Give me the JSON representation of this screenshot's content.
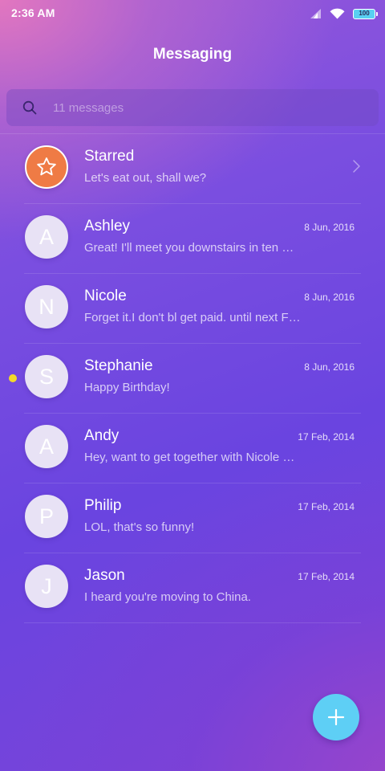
{
  "status_bar": {
    "time": "2:36 AM",
    "battery": "100",
    "icons": [
      "signal-icon",
      "wifi-icon",
      "battery-icon"
    ]
  },
  "header": {
    "title": "Messaging"
  },
  "search": {
    "placeholder": "11 messages",
    "icon": "search-icon"
  },
  "conversations": [
    {
      "name": "Starred",
      "preview": "Let's eat out, shall we?",
      "date": "",
      "avatar_icon": "star-icon",
      "avatar_color": "#ef7b45",
      "starred": true,
      "unread": false
    },
    {
      "name": "Ashley",
      "initial": "A",
      "preview": "Great! I'll meet you downstairs in ten …",
      "date": "8 Jun, 2016",
      "unread": false
    },
    {
      "name": "Nicole",
      "initial": "N",
      "preview": "Forget it.I don't bl get paid. until next F…",
      "date": "8 Jun, 2016",
      "unread": false
    },
    {
      "name": "Stephanie",
      "initial": "S",
      "preview": "Happy Birthday!",
      "date": "8 Jun, 2016",
      "unread": true
    },
    {
      "name": "Andy",
      "initial": "A",
      "preview": "Hey, want to get together with Nicole …",
      "date": "17 Feb, 2014",
      "unread": false
    },
    {
      "name": "Philip",
      "initial": "P",
      "preview": "LOL, that's so funny!",
      "date": "17 Feb, 2014",
      "unread": false
    },
    {
      "name": "Jason",
      "initial": "J",
      "preview": "I heard you're moving to China.",
      "date": "17 Feb, 2014",
      "unread": false
    }
  ],
  "fab": {
    "icon": "plus-icon",
    "color": "#5ecff5"
  },
  "colors": {
    "unread_dot": "#f3d92a",
    "avatar_bg": "#e8e2f5"
  }
}
